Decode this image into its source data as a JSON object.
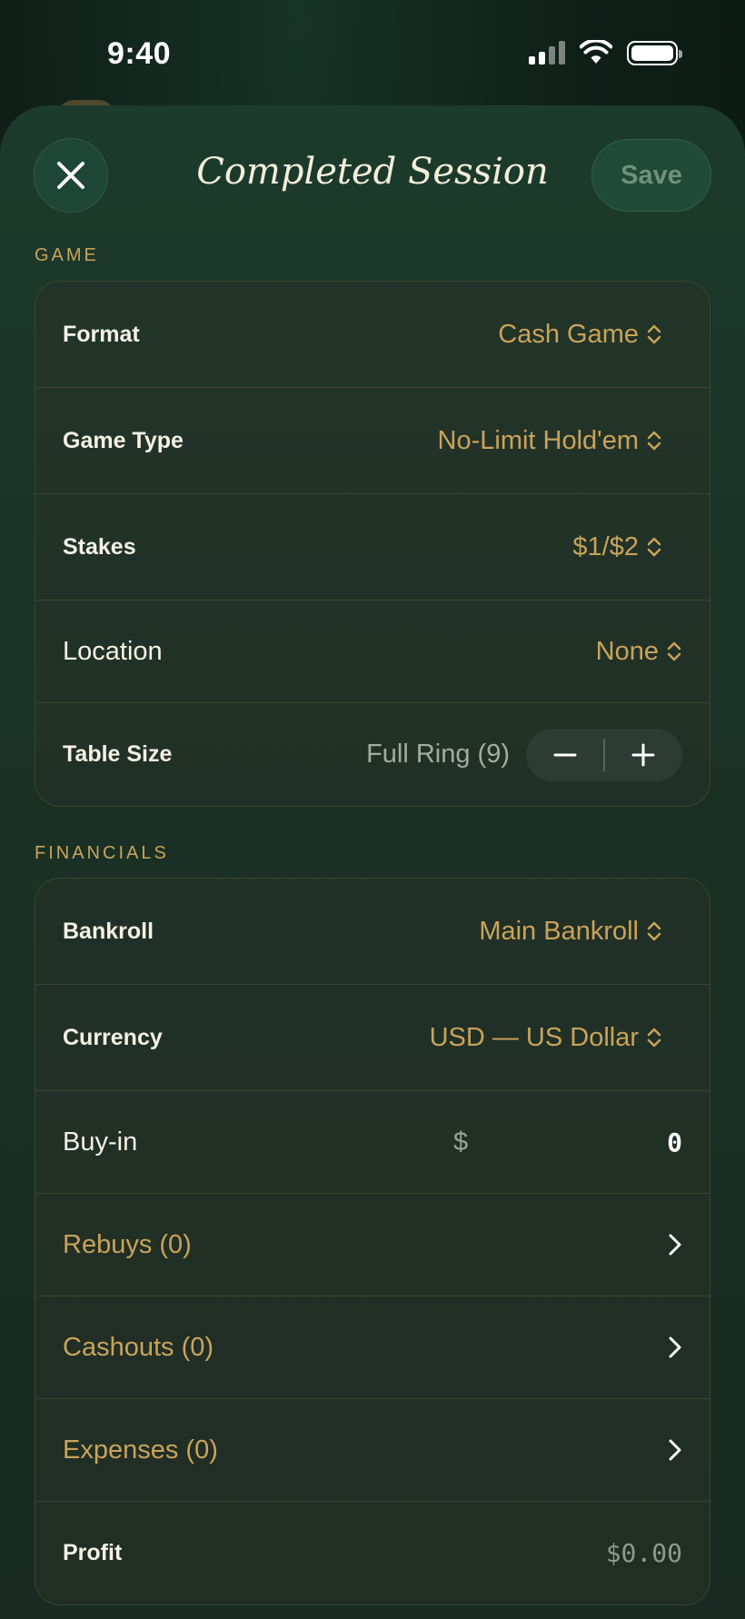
{
  "status_bar": {
    "time": "9:40"
  },
  "header": {
    "title": "Completed Session",
    "save_label": "Save"
  },
  "game": {
    "section_label": "GAME",
    "format": {
      "label": "Format",
      "value": "Cash Game"
    },
    "game_type": {
      "label": "Game Type",
      "value": "No-Limit Hold'em"
    },
    "stakes": {
      "label": "Stakes",
      "value": "$1/$2"
    },
    "location": {
      "label": "Location",
      "value": "None"
    },
    "table_size": {
      "label": "Table Size",
      "value": "Full Ring (9)"
    }
  },
  "financials": {
    "section_label": "FINANCIALS",
    "bankroll": {
      "label": "Bankroll",
      "value": "Main Bankroll"
    },
    "currency": {
      "label": "Currency",
      "value": "USD — US Dollar"
    },
    "buyin": {
      "label": "Buy-in",
      "symbol": "$",
      "value": "0"
    },
    "rebuys": {
      "label": "Rebuys (0)"
    },
    "cashouts": {
      "label": "Cashouts (0)"
    },
    "expenses": {
      "label": "Expenses (0)"
    },
    "profit": {
      "label": "Profit",
      "value": "$0.00"
    }
  },
  "colors": {
    "accent_gold": "#c9a35a",
    "sheet_green": "#1c3b2c",
    "save_button": "#1f4a38"
  },
  "icons": [
    "close-icon",
    "updown-chevron-icon",
    "minus-icon",
    "plus-icon",
    "chevron-right-icon",
    "signal-icon",
    "wifi-icon",
    "battery-icon"
  ]
}
